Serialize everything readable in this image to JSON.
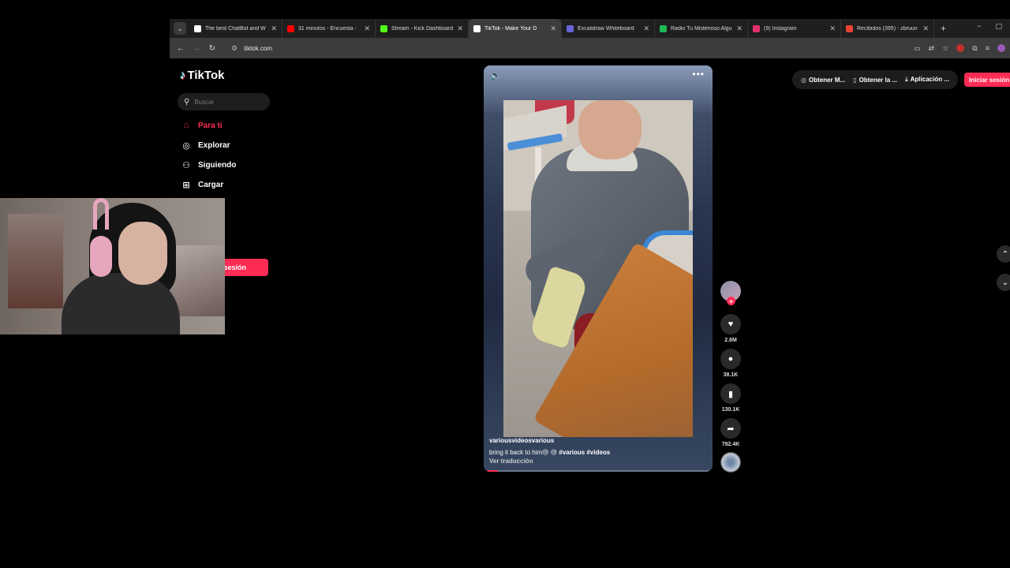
{
  "browser": {
    "tabs": [
      {
        "title": "The best ChatBot and W",
        "favicon_color": "#ffffff",
        "active": false
      },
      {
        "title": "31 minutos - Encuesta - ",
        "favicon_color": "#ff0000",
        "active": false
      },
      {
        "title": "Stream - Kick Dashboard",
        "favicon_color": "#53fc18",
        "active": false
      },
      {
        "title": "TikTok - Make Your D",
        "favicon_color": "#ffffff",
        "active": true
      },
      {
        "title": "Excalidraw Whiteboard",
        "favicon_color": "#6965db",
        "active": false
      },
      {
        "title": "Radio Tu Misterioso Algu",
        "favicon_color": "#1db954",
        "active": false
      },
      {
        "title": "(9) Instagram",
        "favicon_color": "#e1306c",
        "active": false
      },
      {
        "title": "Recibidos (395) - zbruun",
        "favicon_color": "#ea4335",
        "active": false
      }
    ],
    "close_glyph": "✕",
    "new_tab_glyph": "+",
    "window_controls": [
      "−",
      "▢"
    ],
    "url": "tiktok.com"
  },
  "tiktok": {
    "logo_text": "TikTok",
    "search_placeholder": "Buscar",
    "nav": [
      {
        "label": "Para ti",
        "icon": "home-icon",
        "glyph": "⌂",
        "active": true
      },
      {
        "label": "Explorar",
        "icon": "compass-icon",
        "glyph": "◎",
        "active": false
      },
      {
        "label": "Siguiendo",
        "icon": "following-icon",
        "glyph": "⚇",
        "active": false
      },
      {
        "label": "Cargar",
        "icon": "upload-icon",
        "glyph": "⊞",
        "active": false
      }
    ],
    "sidebar_login_label": "sesión",
    "top_actions": {
      "btn1": "Obtener M...",
      "btn2": "Obtener la ...",
      "btn3": "Aplicación ...",
      "login": "Iniciar sesión"
    },
    "video": {
      "author": "variousvideosvarious",
      "caption_text": "bring it back to him😢 😢",
      "hashtags": [
        "#various",
        "#videos"
      ],
      "translate_label": "Ver traducción",
      "progress": 0.05
    },
    "actions": {
      "likes": "2.8M",
      "comments": "38.1K",
      "saves": "130.1K",
      "shares": "792.4K"
    },
    "accent_color": "#fe2c55"
  }
}
